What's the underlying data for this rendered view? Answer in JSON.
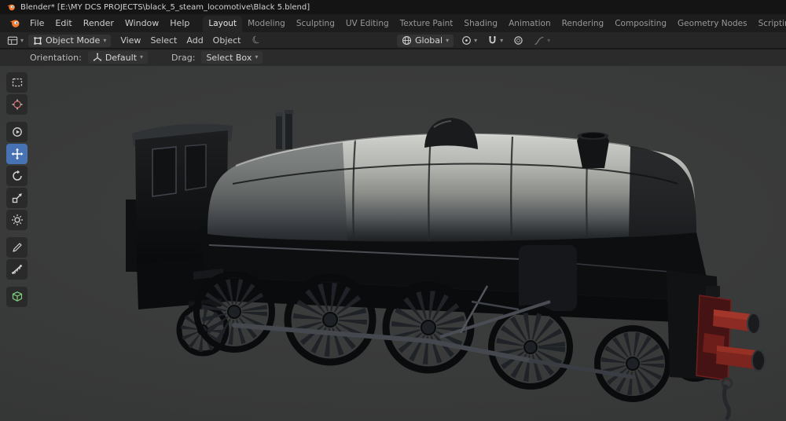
{
  "window": {
    "title": "Blender* [E:\\MY DCS PROJECTS\\black_5_steam_locomotive\\Black 5.blend]"
  },
  "menubar": {
    "menus": [
      "File",
      "Edit",
      "Render",
      "Window",
      "Help"
    ]
  },
  "workspace": {
    "tabs": [
      "Layout",
      "Modeling",
      "Sculpting",
      "UV Editing",
      "Texture Paint",
      "Shading",
      "Animation",
      "Rendering",
      "Compositing",
      "Geometry Nodes",
      "Scripting"
    ],
    "active_tab": "Layout",
    "add_tab": "+"
  },
  "viewport_header": {
    "mode": "Object Mode",
    "menus": [
      "View",
      "Select",
      "Add",
      "Object"
    ],
    "orientation": "Global"
  },
  "tool_settings": {
    "orientation_label": "Orientation:",
    "orientation_value": "Default",
    "drag_label": "Drag:",
    "drag_value": "Select Box"
  },
  "toolbar": {
    "tools": [
      "select-box",
      "cursor",
      "spin",
      "move",
      "rotate",
      "scale",
      "transform",
      "annotate",
      "measure",
      "add-cube"
    ],
    "active_tool": "move"
  },
  "icons": {
    "chevron_down": "▾",
    "crescent_moon": "☾"
  },
  "colors": {
    "accent_blue": "#4772b3",
    "titlebar_bg": "#141414",
    "menubar_bg": "#1d1d1d",
    "header_bg": "#262626",
    "tool_settings_bg": "#2b2b2b",
    "viewport_bg": "#3a3b3b",
    "blender_orange": "#f5792a",
    "boiler_gray": "#b9bcb6",
    "buffer_red": "#8c2b25"
  }
}
